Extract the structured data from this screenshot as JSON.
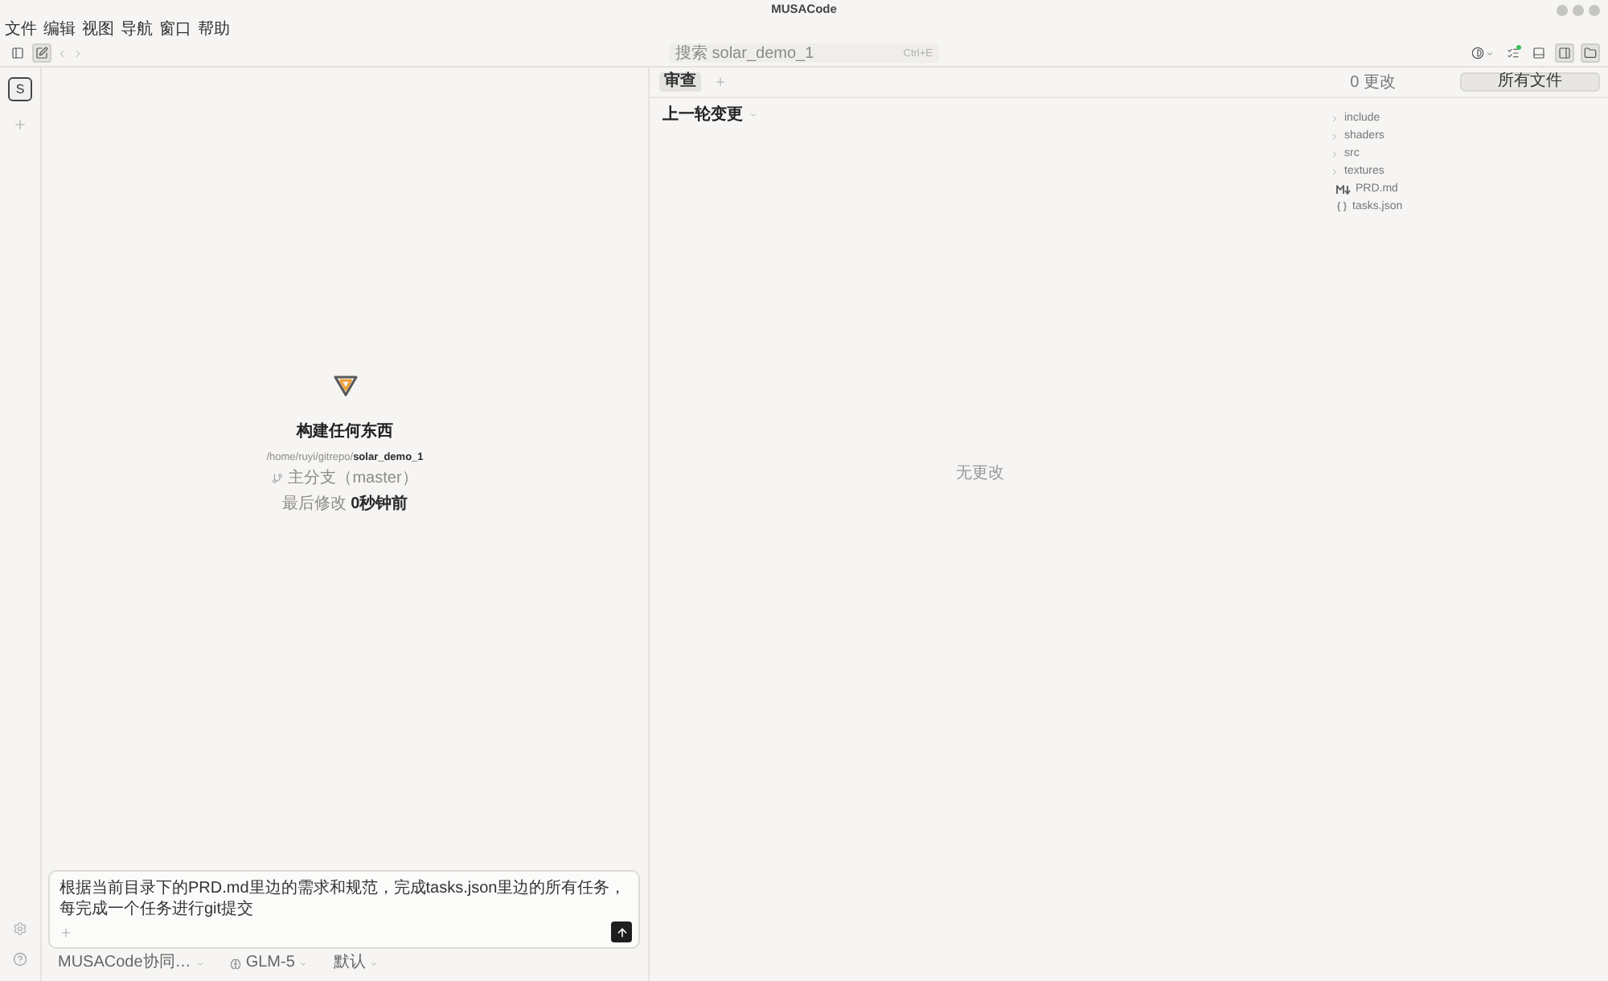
{
  "window": {
    "title": "MUSACode"
  },
  "menu": [
    "文件",
    "编辑",
    "视图",
    "导航",
    "窗口",
    "帮助"
  ],
  "toolbar": {
    "left_toggles": [
      {
        "kind": "sidebar",
        "selected": false
      },
      {
        "kind": "compose",
        "selected": true
      }
    ],
    "history": [
      {
        "kind": "back",
        "disabled": true
      },
      {
        "kind": "forward",
        "disabled": true
      }
    ],
    "search": {
      "placeholder": "搜索 solar_demo_1"
    },
    "shortcut": "Ctrl+E",
    "right_toggles": [
      {
        "kind": "theme",
        "selected": false
      },
      {
        "kind": "tasks",
        "selected": false
      },
      {
        "kind": "terminal",
        "selected": false
      },
      {
        "kind": "review",
        "selected": true
      },
      {
        "kind": "files",
        "selected": true
      }
    ]
  },
  "rail": {
    "avatar": "S"
  },
  "agent": {
    "title": "构建任何东西",
    "path": "/home/ruyi/gitrepo/**solar_demo_1**",
    "branch": "主分支（master）",
    "modified": "最后修改 **0秒钟前**",
    "prompt": {
      "value": "根据当前目录下的PRD.md里边的需求和规范，完成tasks.json里边的所有任务，每完成一个任务进行git提交"
    },
    "selectors": [
      {
        "kind": "agent",
        "label": "MUSACode协同…"
      },
      {
        "kind": "model",
        "label": "GLM-5"
      },
      {
        "kind": "mode",
        "label": "默认"
      }
    ]
  },
  "review": {
    "tabs": [
      {
        "label": "审查",
        "selected": true
      }
    ],
    "scope": "上一轮变更",
    "empty": "无更改",
    "changes": "0 更改",
    "filter": "所有文件"
  },
  "files": {
    "tree": [
      {
        "kind": "folder",
        "name": "include",
        "expanded": false
      },
      {
        "kind": "folder",
        "name": "shaders",
        "expanded": false
      },
      {
        "kind": "folder",
        "name": "src",
        "expanded": false
      },
      {
        "kind": "folder",
        "name": "textures",
        "expanded": false
      },
      {
        "kind": "markdown",
        "name": "PRD.md"
      },
      {
        "kind": "json",
        "name": "tasks.json"
      }
    ]
  }
}
